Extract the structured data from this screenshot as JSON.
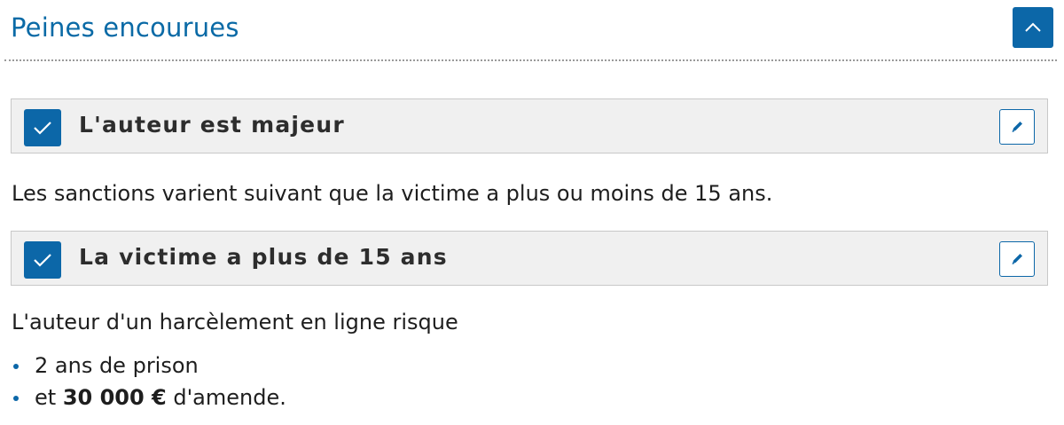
{
  "section": {
    "title": "Peines encourues"
  },
  "steps": [
    {
      "label": "L'auteur est majeur"
    },
    {
      "label": "La victime a plus de 15 ans"
    }
  ],
  "intro_text": "Les sanctions varient suivant que la victime a plus ou moins de 15 ans.",
  "risk_text": "L'auteur d'un harcèlement en ligne risque",
  "penalties": [
    {
      "prefix": "2 ans de prison",
      "amount": "",
      "suffix": ""
    },
    {
      "prefix": "et ",
      "amount": "30 000 €",
      "suffix": " d'amende."
    }
  ],
  "colors": {
    "accent": "#0c67a8",
    "title": "#0a6aa6",
    "box_bg": "#f0f0f0"
  },
  "icons": {
    "collapse": "chevron-up-icon",
    "check": "checkmark-icon",
    "edit": "pencil-icon"
  }
}
